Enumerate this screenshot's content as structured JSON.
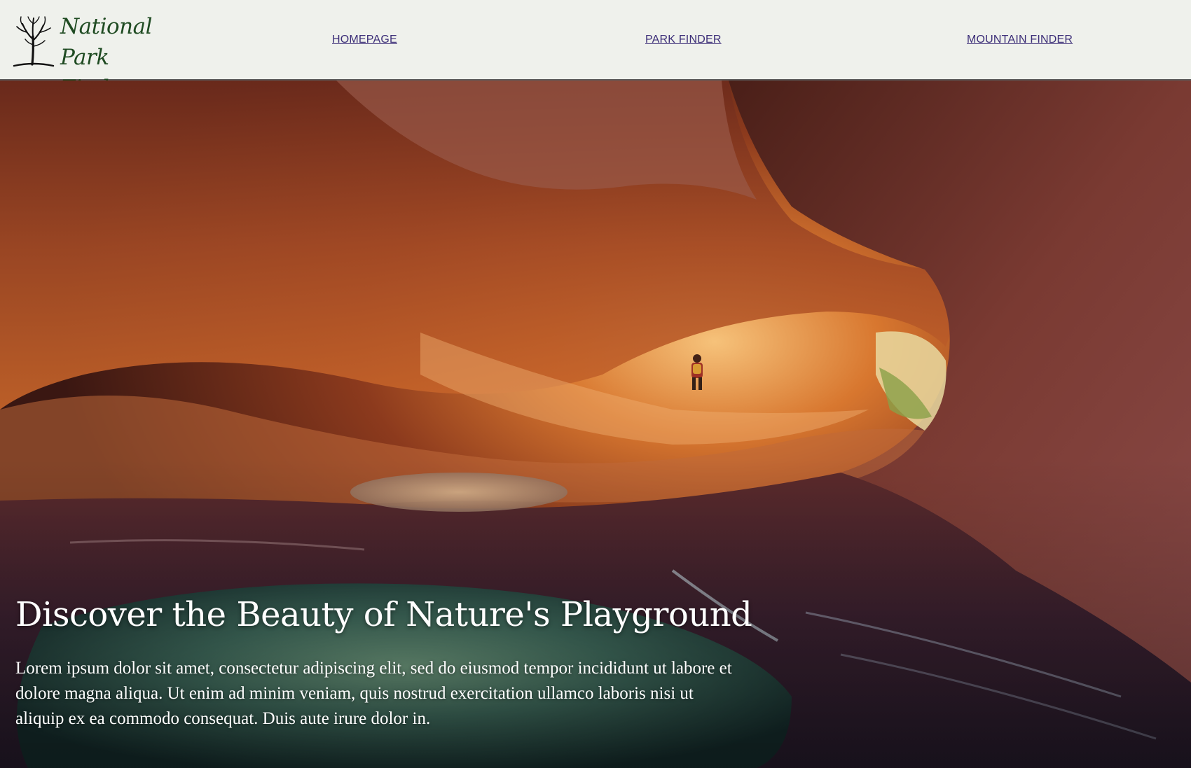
{
  "logo": {
    "line1": "National Park",
    "line2": "Finder",
    "icon": "tree-icon"
  },
  "nav": {
    "homepage": "HOMEPAGE",
    "park_finder": "PARK FINDER",
    "mountain_finder": "MOUNTAIN FINDER"
  },
  "hero": {
    "title": "Discover the Beauty of Nature's Playground",
    "text": "Lorem ipsum dolor sit amet, consectetur adipiscing elit, sed do eiusmod tempor incididunt ut labore et dolore magna aliqua. Ut enim ad minim veniam, quis nostrud exercitation ullamco laboris nisi ut aliquip ex ea commodo consequat. Duis aute irure dolor in."
  },
  "colors": {
    "header_bg": "#eff1ec",
    "logo_green": "#1f4b22",
    "nav_link": "#3c2e78"
  }
}
